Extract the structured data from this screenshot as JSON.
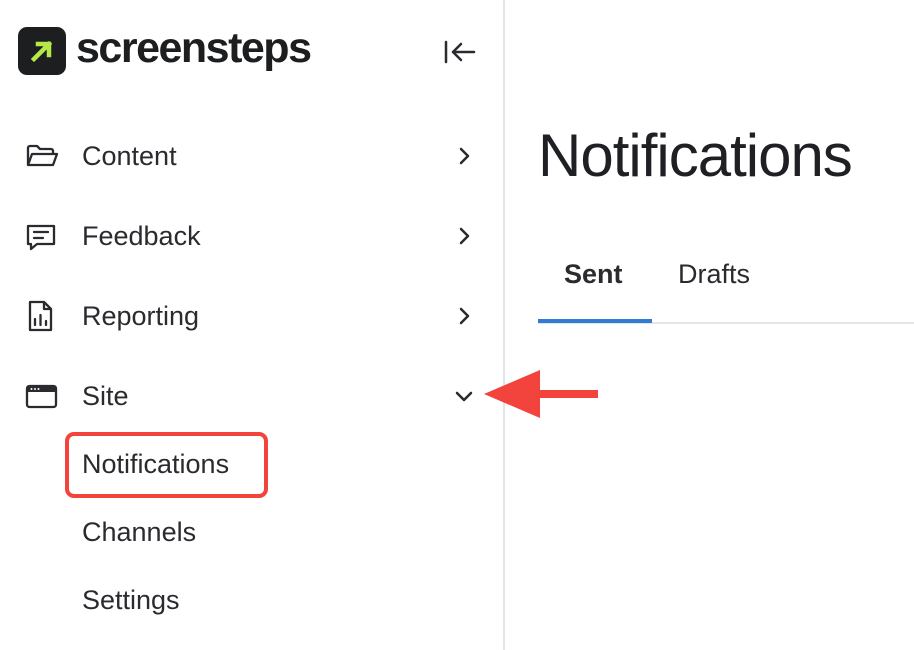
{
  "app": {
    "logo_text": "screensteps"
  },
  "colors": {
    "accent": "#2f7bd6",
    "annotation": "#f2433d",
    "logo_arrow": "#b6e84a"
  },
  "sidebar": {
    "collapse_icon": "collapse-left-icon",
    "items": [
      {
        "label": "Content",
        "icon": "folder-icon",
        "state": "collapsed"
      },
      {
        "label": "Feedback",
        "icon": "chat-icon",
        "state": "collapsed"
      },
      {
        "label": "Reporting",
        "icon": "report-icon",
        "state": "collapsed"
      },
      {
        "label": "Site",
        "icon": "browser-icon",
        "state": "expanded"
      }
    ],
    "sub_items": [
      {
        "label": "Notifications",
        "highlighted": true
      },
      {
        "label": "Channels"
      },
      {
        "label": "Settings"
      }
    ]
  },
  "main": {
    "title": "Notifications",
    "tabs": [
      {
        "label": "Sent",
        "active": true
      },
      {
        "label": "Drafts",
        "active": false
      }
    ]
  }
}
